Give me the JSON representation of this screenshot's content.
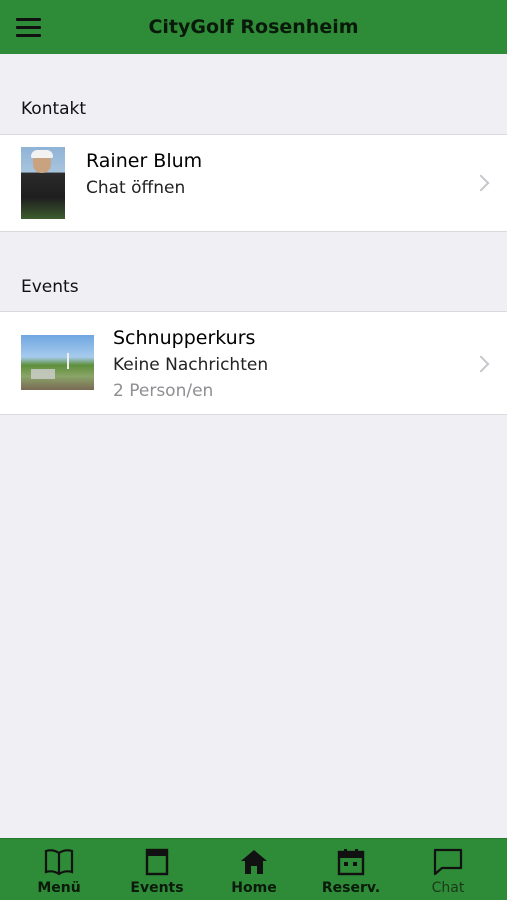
{
  "header": {
    "title": "CityGolf Rosenheim"
  },
  "sections": {
    "kontakt": {
      "title": "Kontakt"
    },
    "events": {
      "title": "Events"
    }
  },
  "contact": {
    "name": "Rainer Blum",
    "subtitle": "Chat öffnen"
  },
  "event": {
    "name": "Schnupperkurs",
    "subtitle": "Keine Nachrichten",
    "participants": "2 Person/en"
  },
  "tabs": [
    {
      "label": "Menü",
      "icon": "book-icon"
    },
    {
      "label": "Events",
      "icon": "document-icon"
    },
    {
      "label": "Home",
      "icon": "home-icon"
    },
    {
      "label": "Reserv.",
      "icon": "calendar-icon"
    },
    {
      "label": "Chat",
      "icon": "chat-icon"
    }
  ],
  "colors": {
    "brand_green": "#2e8b37",
    "background": "#efeff4"
  }
}
